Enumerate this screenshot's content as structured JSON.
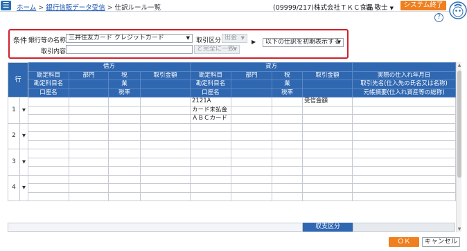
{
  "header": {
    "crumb_home": "ホーム",
    "crumb_bank": "銀行信販データ受信",
    "crumb_current": "仕訳ルール一覧",
    "sep": ">",
    "company": "(09999/217)株式会社ＴＫＣ食品",
    "user": "堤 敬士",
    "system_exit": "システム終了",
    "help": "?"
  },
  "conditions": {
    "title": "条件",
    "bank_label": "銀行等の名称",
    "bank_value": "三井住友カード クレジットカード",
    "trans_type_label": "取引区分",
    "trans_type_value": "出金",
    "content_label": "取引内容",
    "content_value": "",
    "match_value": "と完全に一致",
    "display_value": "以下の仕訳を初期表示する"
  },
  "table": {
    "debit": "借方",
    "credit": "貸方",
    "row_header": "行",
    "d_r1": [
      "勘定科目",
      "部門",
      "税",
      "取引金額"
    ],
    "d_r2": [
      "勘定科目名",
      "業"
    ],
    "d_r3": [
      "口座名",
      "税率"
    ],
    "c_r1": [
      "勘定科目",
      "部門",
      "税",
      "取引金額"
    ],
    "c_r2": [
      "勘定科目名",
      "業"
    ],
    "c_r3": [
      "口座名",
      "税率"
    ],
    "extra": [
      "実際の仕入れ年月日",
      "取引先名(仕入先の氏名又は名称)",
      "元帳摘要(仕入れ資産等の総称)"
    ],
    "rows": [
      {
        "num": "1",
        "credit_code": "2121A",
        "credit_amount": "受信金額",
        "credit_name": "カード未払金",
        "credit_account": "ＡＢＣカード"
      },
      {
        "num": "2",
        "credit_code": "",
        "credit_amount": "",
        "credit_name": "",
        "credit_account": ""
      },
      {
        "num": "3",
        "credit_code": "",
        "credit_amount": "",
        "credit_name": "",
        "credit_account": ""
      },
      {
        "num": "4",
        "credit_code": "",
        "credit_amount": "",
        "credit_name": "",
        "credit_account": ""
      }
    ],
    "balance_label": "収支区分"
  },
  "footer": {
    "ok": "ＯＫ",
    "cancel": "キャンセル"
  },
  "colors": {
    "header_blue": "#2f67b1",
    "accent_orange": "#f07f1e",
    "highlight_red": "#d0202a"
  }
}
